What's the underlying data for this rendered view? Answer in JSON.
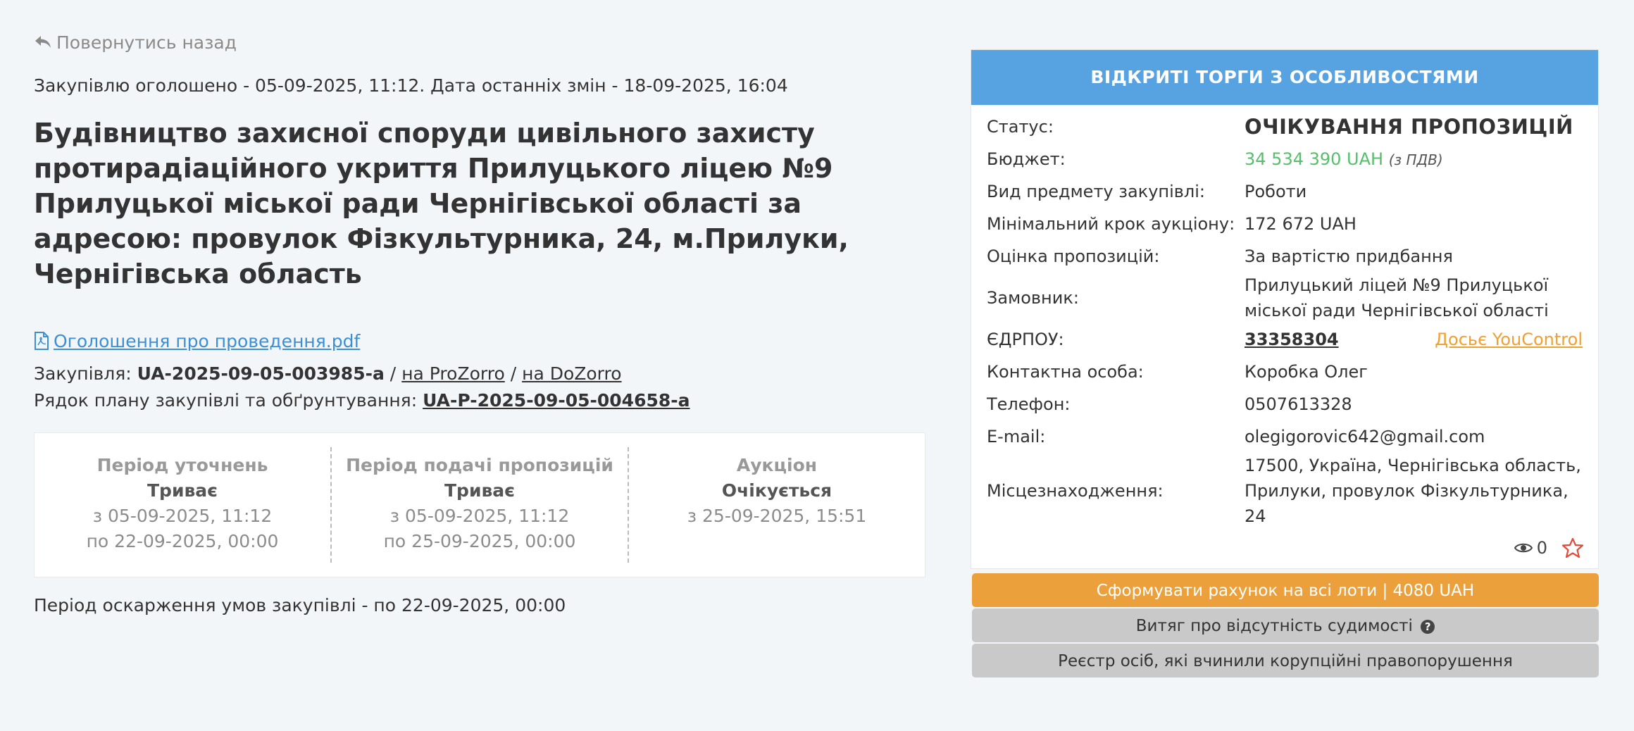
{
  "back_label": "Повернутись назад",
  "announce": "Закупівлю оголошено - 05-09-2025, 11:12. Дата останніх змін - 18-09-2025, 16:04",
  "title": "Будівництво захисної споруди цивільного захисту протирадіаційного укриття Прилуцького ліцею №9 Прилуцької міської ради Чернігівської області за адресою: провулок Фізкультурника, 24, м.Прилуки, Чернігівська область",
  "document_link": "Оголошення про проведення.pdf",
  "procurement": {
    "label": "Закупівля:",
    "id": "UA-2025-09-05-003985-a",
    "sep": "/",
    "prozorro": "на ProZorro",
    "dozorro": "на DoZorro"
  },
  "plan": {
    "label": "Рядок плану закупівлі та обґрунтування:",
    "id": "UA-P-2025-09-05-004658-a"
  },
  "periods": [
    {
      "title": "Період уточнень",
      "status": "Триває",
      "from": "з 05-09-2025, 11:12",
      "to": "по 22-09-2025, 00:00"
    },
    {
      "title": "Період подачі пропозицій",
      "status": "Триває",
      "from": "з 05-09-2025, 11:12",
      "to": "по 25-09-2025, 00:00"
    },
    {
      "title": "Аукціон",
      "status": "Очікується",
      "from": "з 25-09-2025, 15:51",
      "to": ""
    }
  ],
  "appeal": "Період оскарження умов закупівлі - по 22-09-2025, 00:00",
  "card": {
    "header": "ВІДКРИТІ ТОРГИ З ОСОБЛИВОСТЯМИ",
    "status_label": "Статус:",
    "status_value": "ОЧІКУВАННЯ ПРОПОЗИЦІЙ",
    "budget_label": "Бюджет:",
    "budget_value": "34 534 390 UAH",
    "budget_vat": "(з ПДВ)",
    "subject_label": "Вид предмету закупівлі:",
    "subject_value": "Роботи",
    "step_label": "Мінімальний крок аукціону:",
    "step_value": "172 672 UAH",
    "evaluation_label": "Оцінка пропозицій:",
    "evaluation_value": "За вартістю придбання",
    "customer_label": "Замовник:",
    "customer_value": "Прилуцький ліцей №9 Прилуцької міської ради Чернігівської області",
    "edrpou_label": "ЄДРПОУ:",
    "edrpou_value": "33358304",
    "youcontrol": "Досьє YouControl",
    "contact_label": "Контактна особа:",
    "contact_value": "Коробка Олег",
    "phone_label": "Телефон:",
    "phone_value": "0507613328",
    "email_label": "E-mail:",
    "email_value": "olegigorovic642@gmail.com",
    "location_label": "Місцезнаходження:",
    "location_value": "17500, Україна, Чернігівська область, Прилуки, провулок Фізкультурника, 24",
    "views": "0"
  },
  "buttons": {
    "invoice": "Сформувати рахунок на всі лоти | 4080 UAH",
    "criminal": "Витяг про відсутність судимості",
    "corruption": "Реєстр осіб, які вчинили корупційні правопорушення"
  },
  "colors": {
    "header_blue": "#57a3e2",
    "budget_green": "#55bf6a",
    "orange": "#eba03b",
    "star_red": "#e04b3c"
  }
}
